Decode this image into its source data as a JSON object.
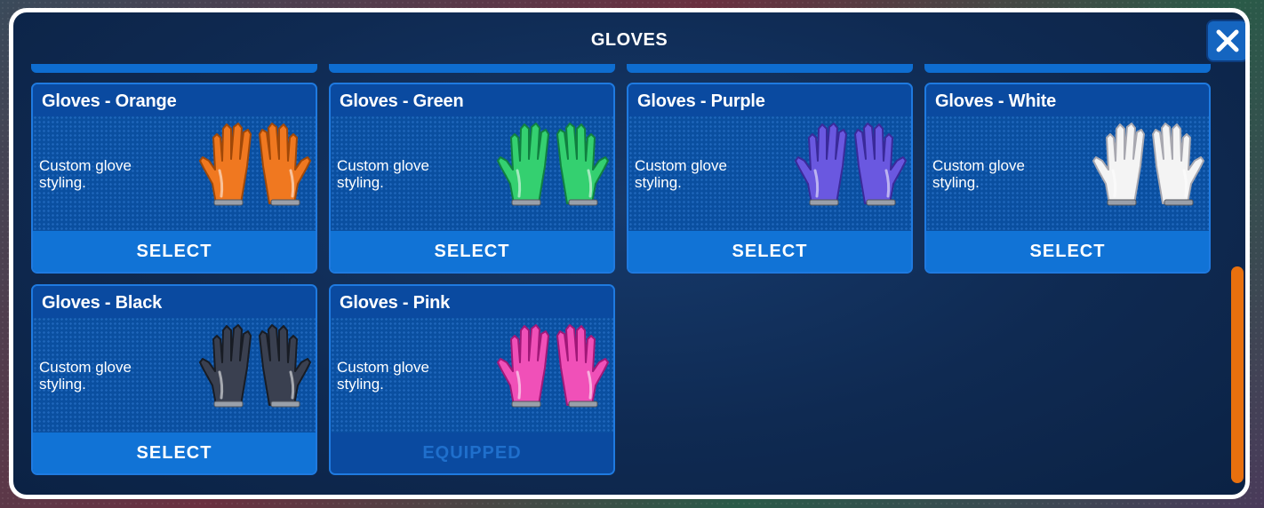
{
  "modal": {
    "title": "GLOVES"
  },
  "cards": [
    {
      "title": "Gloves - Orange",
      "description": "Custom glove styling.",
      "button": "SELECT",
      "color": "#f07820",
      "dark": "#a04808",
      "state": "select"
    },
    {
      "title": "Gloves - Green",
      "description": "Custom glove styling.",
      "button": "SELECT",
      "color": "#34d070",
      "dark": "#108040",
      "state": "select"
    },
    {
      "title": "Gloves - Purple",
      "description": "Custom glove styling.",
      "button": "SELECT",
      "color": "#6a58e0",
      "dark": "#3a2a9a",
      "state": "select"
    },
    {
      "title": "Gloves - White",
      "description": "Custom glove styling.",
      "button": "SELECT",
      "color": "#f4f4f4",
      "dark": "#a8a8b0",
      "state": "select"
    },
    {
      "title": "Gloves - Black",
      "description": "Custom glove styling.",
      "button": "SELECT",
      "color": "#3a4050",
      "dark": "#181c24",
      "state": "select"
    },
    {
      "title": "Gloves - Pink",
      "description": "Custom glove styling.",
      "button": "EQUIPPED",
      "color": "#f050b8",
      "dark": "#a01878",
      "state": "equipped"
    }
  ],
  "theme": {
    "accent": "#1173d6",
    "scrollbar": "#e8700e",
    "panel": "#0f2a52"
  },
  "icons": {
    "close": "close-icon",
    "glove": "glove-icon"
  }
}
